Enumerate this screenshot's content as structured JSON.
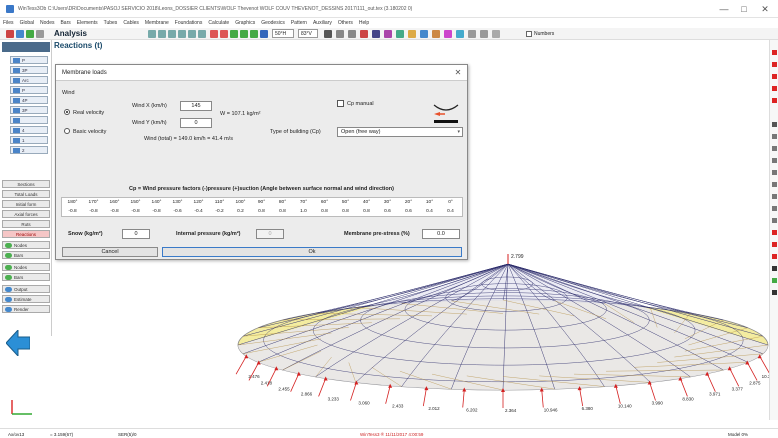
{
  "window": {
    "title": "WinTess3Ob  C:\\Users\\DR\\Documents\\PASOJ SERVICIO 2018\\Leons_DOSSIER CLIENTS\\WOLF Thevenot WOLF COUV THEVENOT_DESSINS 2017\\111_out.tex (3.180202 0)",
    "minimize": "—",
    "maximize": "□",
    "close": "✕"
  },
  "menu": [
    "Files",
    "Global",
    "Nodes",
    "Bars",
    "Elements",
    "Tubes",
    "Cables",
    "Membrane",
    "Foundations",
    "Calculate",
    "Graphics",
    "Geodesics",
    "Pattern",
    "Auxiliary",
    "Others",
    "Help"
  ],
  "toolbar": {
    "module": "Analysis",
    "zoom1": "50°H",
    "zoom2": "83°V",
    "numbers_label": "Numbers"
  },
  "sidebar": {
    "small_buttons": [
      "P",
      "3P",
      "Arc",
      "P",
      "4P",
      "3P",
      "",
      "4",
      "1",
      "2"
    ],
    "nav": [
      "Sections",
      "Total Loads",
      "Initial form",
      "Axial forces",
      "Ruts",
      "Reactions",
      "Nodes",
      "Bars",
      "Nodes",
      "Bars",
      "Output",
      "Estimate",
      "Render"
    ],
    "active": "Reactions"
  },
  "panel_title": "Reactions (t)",
  "dialog": {
    "title": "Membrane loads",
    "close": "✕",
    "wind_group": "Wind",
    "real_velocity": "Real velocity",
    "basic_velocity": "Basic velocity",
    "wind_x_label": "Wind X (km/h)",
    "wind_x_value": "145",
    "wind_y_label": "Wind Y (km/h)",
    "wind_y_value": "0",
    "w_result": "W = 107.1 kg/m²",
    "wind_total": "Wind (total) = 149.0 km/h = 41.4 m/s",
    "cp_manual": "Cp manual",
    "building_type_label": "Type of building (Cp)",
    "building_type_value": "Open (free way)",
    "cp_heading": "Cp = Wind pressure factors (-)pressure (+)suction    (Angle between surface normal and wind direction)",
    "angles": [
      "180°",
      "170°",
      "160°",
      "150°",
      "140°",
      "130°",
      "120°",
      "110°",
      "100°",
      "90°",
      "80°",
      "70°",
      "60°",
      "50°",
      "40°",
      "30°",
      "20°",
      "10°",
      "0°"
    ],
    "cp_values": [
      "-0.8",
      "-0.8",
      "-0.8",
      "-0.8",
      "-0.8",
      "-0.6",
      "-0.4",
      "-0.2",
      "0.2",
      "0.8",
      "0.8",
      "1.0",
      "0.8",
      "0.8",
      "0.8",
      "0.6",
      "0.6",
      "0.4",
      "0.4"
    ],
    "snow_label": "Snow (kg/m²)",
    "snow_value": "0",
    "internal_label": "Internal pressure (kg/m²)",
    "internal_value": "0",
    "prestress_label": "Membrane pre-stress (%)",
    "prestress_value": "0.0",
    "cancel": "Cancel",
    "ok": "Ok"
  },
  "reactions": {
    "apex": "2.799",
    "labels": [
      "2.476",
      "2.418",
      "2.455",
      "2.866",
      "3.233",
      "3.060",
      "2.433",
      "2.012",
      "6.202",
      "2.364",
      "10.946",
      "6.380",
      "10.140",
      "3.990",
      "8.830",
      "3.971",
      "3.377",
      "2.875",
      "10.399"
    ]
  },
  "status": {
    "left1": "Ax/ov13",
    "left2": "= 3.159(67)",
    "left3": "SER(5)/0",
    "center": "WinTess3 ® 11/11/2017 4:00:59",
    "right": "Model 0%"
  },
  "colors": {
    "membrane": "#f3eca0",
    "mesh": "#2a2a6a",
    "reaction": "#d42020",
    "accent": "#3a7ac8"
  }
}
